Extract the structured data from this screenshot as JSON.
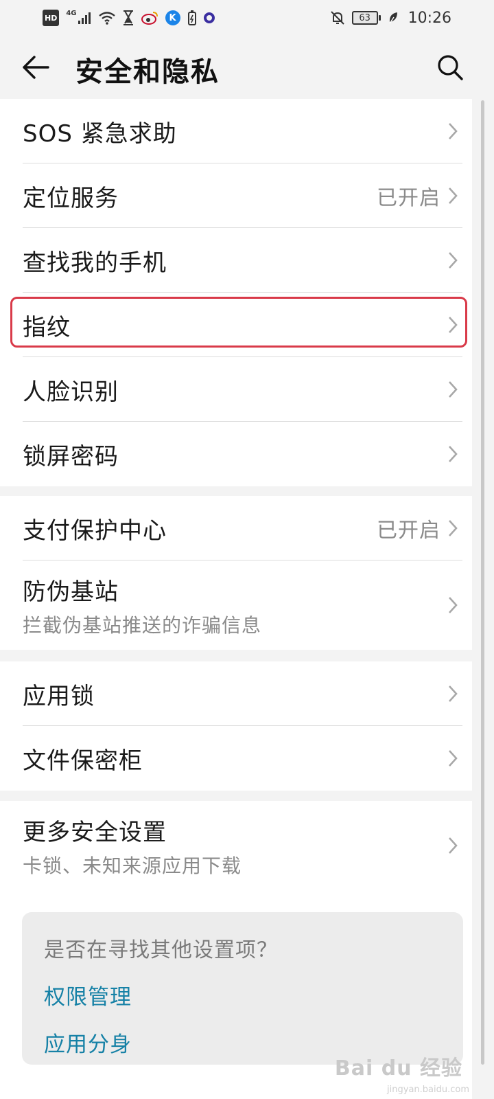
{
  "status_bar": {
    "hd": "HD",
    "network": "4G",
    "icons": [
      "signal-icon",
      "wifi-icon",
      "hourglass-icon",
      "weibo-icon",
      "k-app-icon",
      "battery-saver-icon",
      "ring-app-icon",
      "mute-icon",
      "leaf-icon"
    ],
    "k_label": "K",
    "battery_level": "63",
    "time": "10:26"
  },
  "header": {
    "title": "安全和隐私",
    "back_icon": "arrow-left-icon",
    "search_icon": "search-icon"
  },
  "groups": [
    {
      "items": [
        {
          "label": "SOS 紧急求助",
          "value": "",
          "sub": ""
        },
        {
          "label": "定位服务",
          "value": "已开启",
          "sub": ""
        },
        {
          "label": "查找我的手机",
          "value": "",
          "sub": ""
        },
        {
          "label": "指纹",
          "value": "",
          "sub": "",
          "highlighted": true
        },
        {
          "label": "人脸识别",
          "value": "",
          "sub": ""
        },
        {
          "label": "锁屏密码",
          "value": "",
          "sub": ""
        }
      ]
    },
    {
      "items": [
        {
          "label": "支付保护中心",
          "value": "已开启",
          "sub": ""
        },
        {
          "label": "防伪基站",
          "value": "",
          "sub": "拦截伪基站推送的诈骗信息"
        }
      ]
    },
    {
      "items": [
        {
          "label": "应用锁",
          "value": "",
          "sub": ""
        },
        {
          "label": "文件保密柜",
          "value": "",
          "sub": ""
        }
      ]
    },
    {
      "items": [
        {
          "label": "更多安全设置",
          "value": "",
          "sub": "卡锁、未知来源应用下载"
        }
      ]
    }
  ],
  "suggestion": {
    "title": "是否在寻找其他设置项？",
    "links": [
      "权限管理",
      "应用分身"
    ]
  },
  "watermark": {
    "text": "Bai du 经验",
    "sub": "jingyan.baidu.com"
  },
  "colors": {
    "accent_link": "#1681a6",
    "highlight_border": "#d93a49",
    "background": "#f3f3f3"
  }
}
